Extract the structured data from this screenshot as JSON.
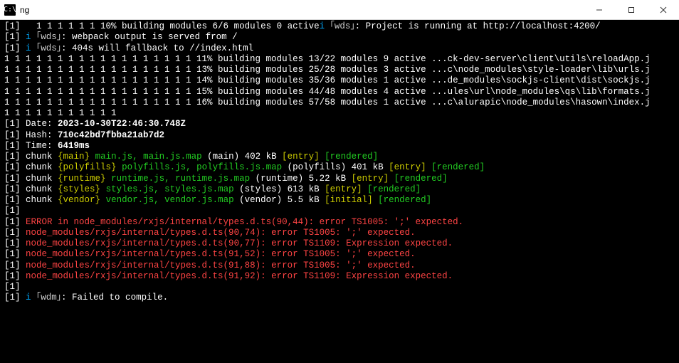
{
  "window": {
    "title": "ng",
    "icon_glyph": "C:\\"
  },
  "build": {
    "percent_line": "  1 1 1 1 1 1 10% building modules 6/6 modules 0 active",
    "wds_running": ": Project is running at http://localhost:4200/",
    "info_i": "i",
    "wds_tag": "｢wds｣",
    "wdm_tag": "｢wdm｣",
    "wds_output": ": webpack output is served from /",
    "wds_404": ": 404s will fallback to //index.html",
    "chart_lines": [
      "1 1 1 1 1 1 1 1 1 1 1 1 1 1 1 1 1 1 11% building modules 13/22 modules 9 active ...ck-dev-server\\client\\utils\\reloadApp.j",
      "1 1 1 1 1 1 1 1 1 1 1 1 1 1 1 1 1 1 13% building modules 25/28 modules 3 active ...c\\node_modules\\style-loader\\lib\\urls.j",
      "1 1 1 1 1 1 1 1 1 1 1 1 1 1 1 1 1 1 14% building modules 35/36 modules 1 active ...de_modules\\sockjs-client\\dist\\sockjs.j",
      "1 1 1 1 1 1 1 1 1 1 1 1 1 1 1 1 1 1 15% building modules 44/48 modules 4 active ...ules\\url\\node_modules\\qs\\lib\\formats.j",
      "1 1 1 1 1 1 1 1 1 1 1 1 1 1 1 1 1 1 16% building modules 57/58 modules 1 active ...c\\alurapic\\node_modules\\hasown\\index.j"
    ],
    "tail_ones": "1 1 1 1 1 1 1 1 1 1 1",
    "date_label": "Date: ",
    "date_value": "2023-10-30T22:46:30.748Z",
    "hash_label": "Hash: ",
    "hash_value": "710c42bd7fbba21ab7d2",
    "time_label": "Time: ",
    "time_value": "6419ms",
    "entry": "[entry]",
    "initial": "[initial]",
    "rendered": "[rendered]",
    "chunk_word": "chunk ",
    "chunks": [
      {
        "key": "{main}",
        "files": "main.js, main.js.map",
        "meta": " (main) 402 kB ",
        "tag": "entry"
      },
      {
        "key": "{polyfills}",
        "files": "polyfills.js, polyfills.js.map",
        "meta": " (polyfills) 401 kB ",
        "tag": "entry"
      },
      {
        "key": "{runtime}",
        "files": "runtime.js, runtime.js.map",
        "meta": " (runtime) 5.22 kB ",
        "tag": "entry"
      },
      {
        "key": "{styles}",
        "files": "styles.js, styles.js.map",
        "meta": " (styles) 613 kB ",
        "tag": "entry"
      },
      {
        "key": "{vendor}",
        "files": "vendor.js, vendor.js.map",
        "meta": " (vendor) 5.5 kB ",
        "tag": "initial"
      }
    ],
    "errors": [
      "ERROR in node_modules/rxjs/internal/types.d.ts(90,44): error TS1005: ';' expected.",
      "node_modules/rxjs/internal/types.d.ts(90,74): error TS1005: ';' expected.",
      "node_modules/rxjs/internal/types.d.ts(90,77): error TS1109: Expression expected.",
      "node_modules/rxjs/internal/types.d.ts(91,52): error TS1005: ';' expected.",
      "node_modules/rxjs/internal/types.d.ts(91,88): error TS1005: ';' expected.",
      "node_modules/rxjs/internal/types.d.ts(91,92): error TS1109: Expression expected."
    ],
    "failed": ": Failed to compile."
  },
  "prefix": "[1] "
}
